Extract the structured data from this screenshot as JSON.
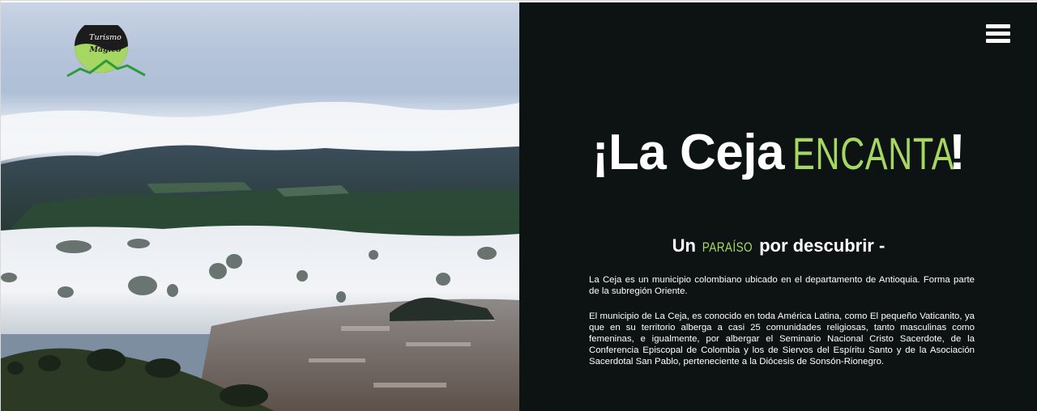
{
  "logo": {
    "line1": "Turismo",
    "line2": "Mágico"
  },
  "menu": {
    "icon": "hamburger-menu-icon"
  },
  "hero": {
    "prefix": "¡La Ceja ",
    "accent": "ENCANTA",
    "suffix": "!"
  },
  "subtitle": {
    "prefix": "Un ",
    "accent": "PARAÍSO",
    "suffix": " por descubrir -"
  },
  "paragraphs": [
    "La Ceja es un municipio colombiano ubicado en el departamento de Antioquia. Forma parte de la subregión Oriente.",
    "El municipio de La Ceja, es conocido en toda América Latina, como El pequeño Vaticanito, ya que en su territorio alberga a casi 25 comunidades religiosas, tanto masculinas como femeninas, e igualmente, por albergar el Seminario Nacional Cristo Sacerdote, de la Conferencia Episcopal de Colombia y los de Siervos del Espíritu Santo y de la Asociación Sacerdotal San Pablo, perteneciente a la Diócesis de Sonsón-Rionegro."
  ],
  "colors": {
    "panel_bg": "#0d1312",
    "accent_green": "#a6d762",
    "text": "#ffffff",
    "logo_dark": "#1c1c1c",
    "logo_line": "#2f9a3a"
  }
}
